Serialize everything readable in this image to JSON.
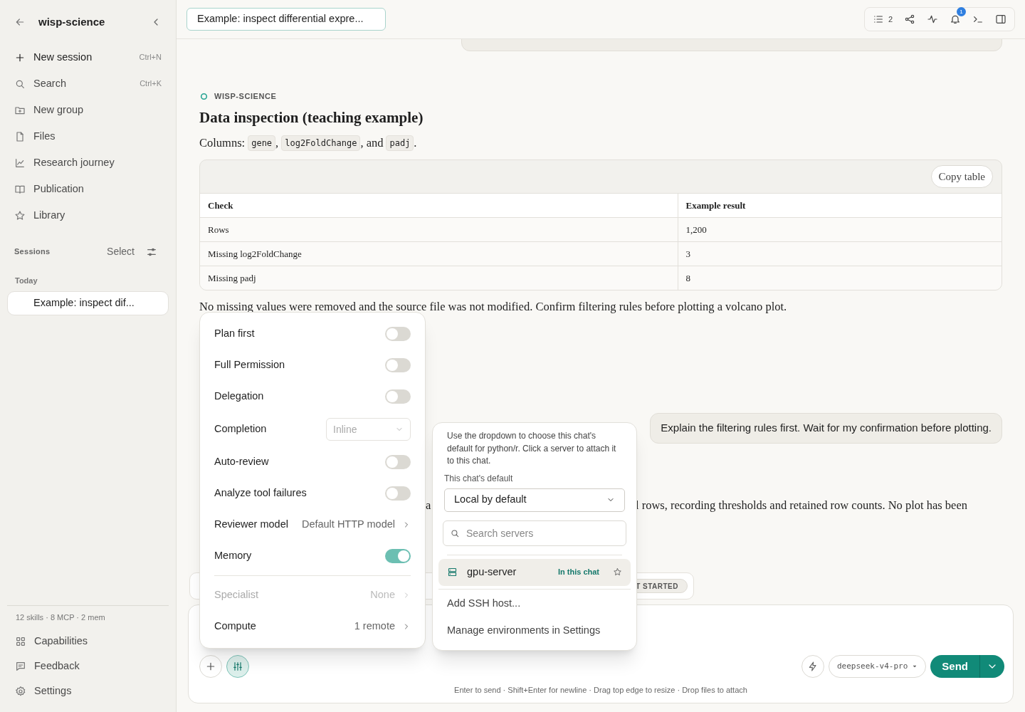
{
  "sidebar": {
    "title": "wisp-science",
    "nav": [
      {
        "label": "New session",
        "shortcut": "Ctrl+N"
      },
      {
        "label": "Search",
        "shortcut": "Ctrl+K"
      },
      {
        "label": "New group"
      },
      {
        "label": "Files"
      },
      {
        "label": "Research journey"
      },
      {
        "label": "Publication"
      },
      {
        "label": "Library"
      }
    ],
    "sessions_label": "Sessions",
    "select_label": "Select",
    "group_label": "Today",
    "sessions": [
      {
        "label": "Example: inspect dif...",
        "selected": true
      }
    ],
    "stats": "12 skills · 8 MCP · 2 mem",
    "footer": [
      {
        "label": "Capabilities"
      },
      {
        "label": "Feedback"
      },
      {
        "label": "Settings"
      }
    ]
  },
  "header": {
    "session_title": "Example: inspect differential expre...",
    "tasks_count": "2",
    "notifications": "1"
  },
  "message": {
    "agent": "WISP-SCIENCE",
    "title": "Data inspection (teaching example)",
    "columns_line": [
      {
        "kind": "text",
        "text": "Columns:"
      },
      {
        "kind": "code",
        "text": "gene"
      },
      {
        "kind": "text",
        "text": ","
      },
      {
        "kind": "code",
        "text": "log2FoldChange"
      },
      {
        "kind": "text",
        "text": ", and"
      },
      {
        "kind": "code",
        "text": "padj"
      },
      {
        "kind": "text",
        "text": "."
      }
    ],
    "copy_button": "Copy table",
    "table": {
      "columns": [
        "Check",
        "Example result"
      ],
      "rows": [
        [
          "Rows",
          "1,200"
        ],
        [
          "Missing log2FoldChange",
          "3"
        ],
        [
          "Missing padj",
          "8"
        ]
      ]
    },
    "note": "No missing values were removed and the source file was not modified. Confirm filtering rules before plotting a volcano plot."
  },
  "user_message": "Explain the filtering rules first. Wait for my confirmation before plotting.",
  "reply_fragments": [
    "a",
    "l rows, recording thresholds and retained row counts. No plot has been"
  ],
  "status_badge": "T STARTED",
  "composer": {
    "model": "deepseek-v4-pro",
    "send": "Send",
    "hint": "Enter to send · Shift+Enter for newline · Drag top edge to resize · Drop files to attach"
  },
  "settings_menu": [
    {
      "kind": "toggle",
      "label": "Plan first",
      "on": false
    },
    {
      "kind": "toggle",
      "label": "Full Permission",
      "on": false
    },
    {
      "kind": "toggle",
      "label": "Delegation",
      "on": false
    },
    {
      "kind": "select",
      "label": "Completion",
      "value": "Inline"
    },
    {
      "kind": "toggle",
      "label": "Auto-review",
      "on": false
    },
    {
      "kind": "toggle",
      "label": "Analyze tool failures",
      "on": false
    },
    {
      "kind": "link",
      "label": "Reviewer model",
      "value": "Default HTTP model",
      "disabled": false
    },
    {
      "kind": "toggle",
      "label": "Memory",
      "on": true
    },
    {
      "kind": "divider"
    },
    {
      "kind": "link",
      "label": "Specialist",
      "value": "None",
      "disabled": true
    },
    {
      "kind": "link",
      "label": "Compute",
      "value": "1 remote",
      "disabled": false
    }
  ],
  "compute_menu": {
    "description": "Use the dropdown to choose this chat's default for python/r. Click a server to attach it to this chat.",
    "default_label": "This chat's default",
    "default_value": "Local by default",
    "search_placeholder": "Search servers",
    "servers": [
      {
        "name": "gpu-server",
        "badge": "In this chat",
        "selected": true,
        "starred": false
      }
    ],
    "actions": [
      "Add SSH host...",
      "Manage environments in Settings"
    ]
  }
}
